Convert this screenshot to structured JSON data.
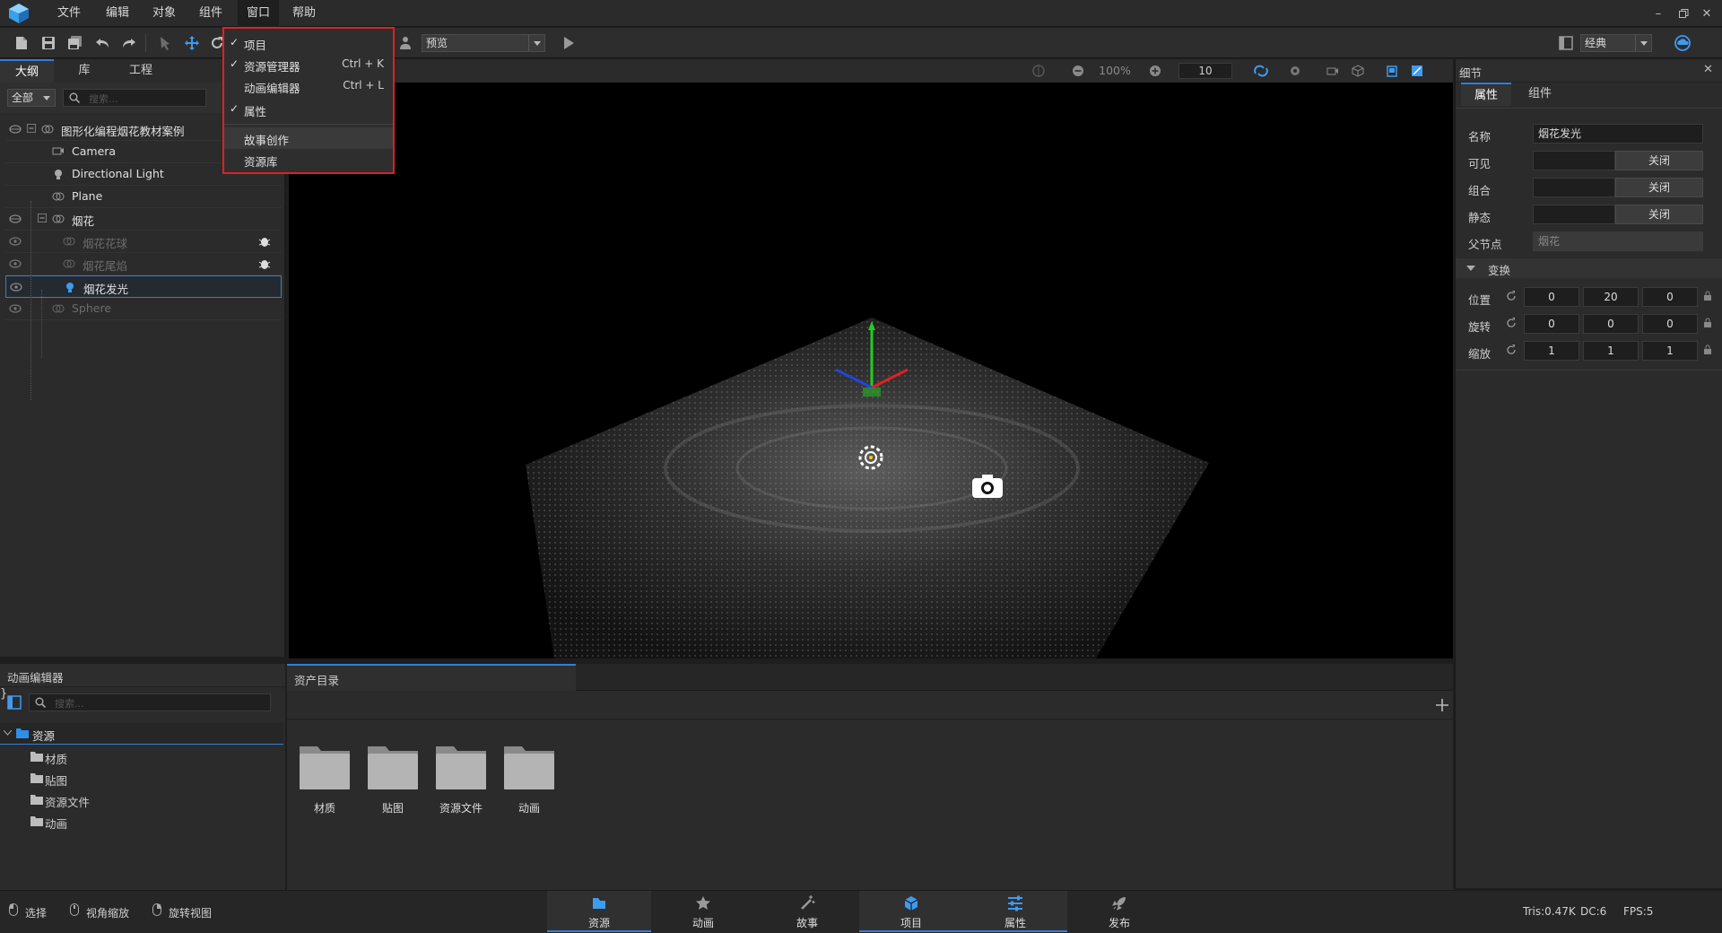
{
  "menubar": {
    "items": [
      "文件",
      "编辑",
      "对象",
      "组件",
      "窗口",
      "帮助"
    ]
  },
  "window_menu": {
    "items": [
      {
        "label": "项目",
        "checked": true,
        "shortcut": ""
      },
      {
        "label": "资源管理器",
        "checked": true,
        "shortcut": "Ctrl + K"
      },
      {
        "label": "动画编辑器",
        "checked": false,
        "shortcut": "Ctrl + L"
      },
      {
        "label": "属性",
        "checked": true,
        "shortcut": ""
      },
      {
        "label": "故事创作",
        "checked": false,
        "shortcut": ""
      },
      {
        "label": "资源库",
        "checked": false,
        "shortcut": ""
      }
    ],
    "check_mark": "✓"
  },
  "toolbar": {
    "preview_combo": "预览",
    "layout_combo": "经典"
  },
  "viewport_bar": {
    "zoom": "100%",
    "grid_value": "10"
  },
  "outline": {
    "tabs": [
      "大纲",
      "库",
      "工程"
    ],
    "filter": "全部",
    "search_placeholder": "搜索...",
    "nodes": [
      {
        "label": "图形化编程烟花教材案例",
        "dim": false
      },
      {
        "label": "Camera",
        "dim": false
      },
      {
        "label": "Directional Light",
        "dim": false
      },
      {
        "label": "Plane",
        "dim": false
      },
      {
        "label": "烟花",
        "dim": false
      },
      {
        "label": "烟花花球",
        "dim": true
      },
      {
        "label": "烟花尾焰",
        "dim": true
      },
      {
        "label": "烟花发光",
        "dim": false
      },
      {
        "label": "Sphere",
        "dim": true
      }
    ]
  },
  "details": {
    "title": "细节",
    "tabs": [
      "属性",
      "组件"
    ],
    "name_label": "名称",
    "name_value": "烟花发光",
    "visible_label": "可见",
    "group_label": "组合",
    "static_label": "静态",
    "toggle_off": "关闭",
    "parent_label": "父节点",
    "parent_value": "烟花",
    "transform_label": "变换",
    "position_label": "位置",
    "rotation_label": "旋转",
    "scale_label": "缩放",
    "position": [
      "0",
      "20",
      "0"
    ],
    "rotation": [
      "0",
      "0",
      "0"
    ],
    "scale": [
      "1",
      "1",
      "1"
    ]
  },
  "anim_editor": {
    "title": "动画编辑器",
    "search_placeholder": "搜索...",
    "root": "资源",
    "folders": [
      "材质",
      "贴图",
      "资源文件",
      "动画"
    ]
  },
  "assets": {
    "tab": "资产目录",
    "folders": [
      "材质",
      "贴图",
      "资源文件",
      "动画"
    ]
  },
  "statusbar": {
    "hints": [
      "选择",
      "视角缩放",
      "旋转视图"
    ],
    "tabs": [
      "资源",
      "动画",
      "故事",
      "项目",
      "属性",
      "发布"
    ],
    "stats": {
      "tris": "Tris:0.47K",
      "dc": "DC:6",
      "fps": "FPS:5"
    }
  },
  "colors": {
    "accent": "#2f7fd8",
    "highlight_border": "#e02020"
  }
}
